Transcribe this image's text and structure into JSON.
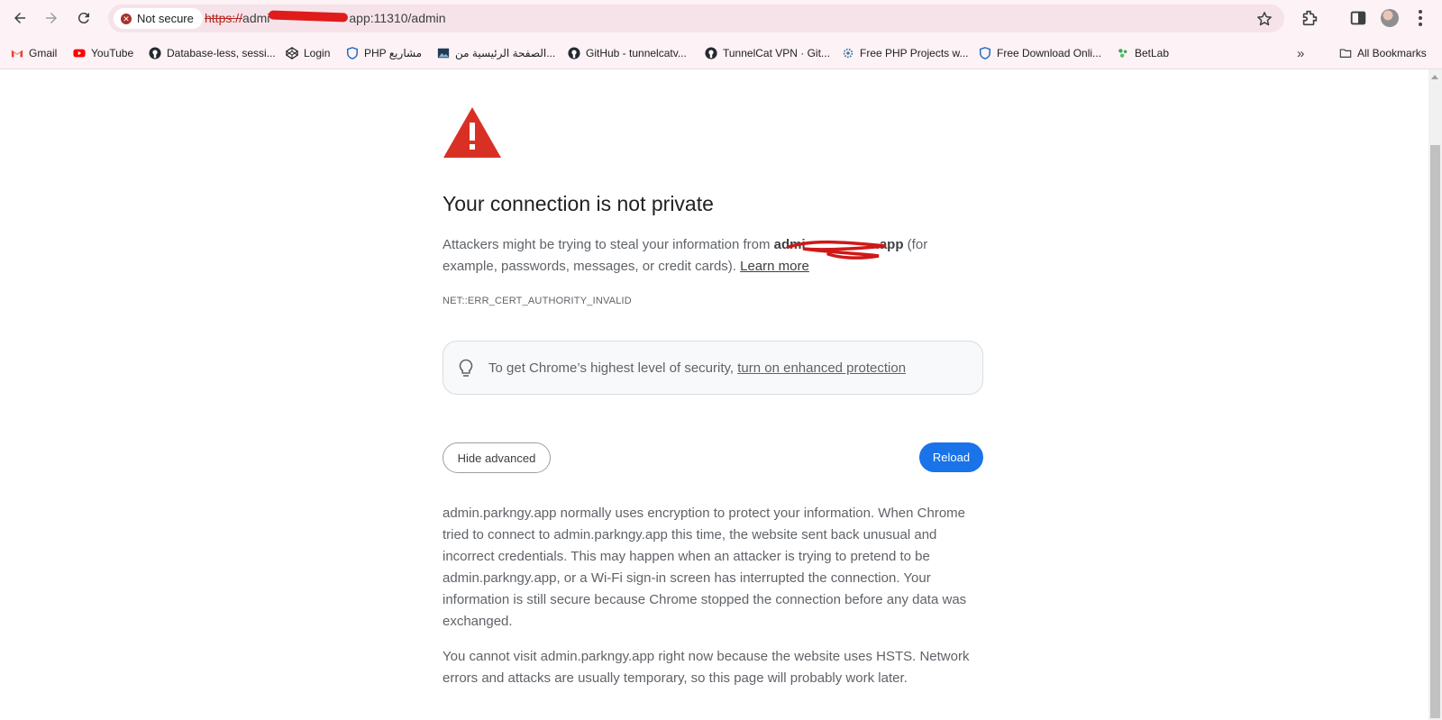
{
  "browser": {
    "security_chip": "Not secure",
    "url_scheme": "https://",
    "url_prefix": "admi",
    "url_suffix": "app:11310/admin"
  },
  "bookmarks": {
    "items": [
      {
        "label": "Gmail",
        "icon": "gmail-icon"
      },
      {
        "label": "YouTube",
        "icon": "youtube-icon"
      },
      {
        "label": "Database-less, sessi...",
        "icon": "github-icon"
      },
      {
        "label": "Login",
        "icon": "codepen-icon"
      },
      {
        "label": "PHP مشاريع",
        "icon": "shield-icon"
      },
      {
        "label": "الصفحة الرئيسية من...",
        "icon": "image-icon"
      },
      {
        "label": "GitHub - tunnelcatv...",
        "icon": "github-icon"
      },
      {
        "label": "TunnelCat VPN · Git...",
        "icon": "github-icon"
      },
      {
        "label": "Free PHP Projects w...",
        "icon": "gear-icon"
      },
      {
        "label": "Free Download Onli...",
        "icon": "shield-icon"
      },
      {
        "label": "BetLab",
        "icon": "leaf-icon"
      }
    ],
    "all_bookmarks": "All Bookmarks"
  },
  "page": {
    "title": "Your connection is not private",
    "message_before": "Attackers might be trying to steal your information from ",
    "host_visible": "admi",
    "host_end": ".app",
    "message_after": " (for example, passwords, messages, or credit cards). ",
    "learn_more": "Learn more",
    "error_code": "NET::ERR_CERT_AUTHORITY_INVALID",
    "enhanced_text": "To get Chrome’s highest level of security, ",
    "enhanced_link": "turn on enhanced protection",
    "hide_advanced": "Hide advanced",
    "reload": "Reload",
    "details_1": "admin.parkngy.app normally uses encryption to protect your information. When Chrome tried to connect to admin.parkngy.app this time, the website sent back unusual and incorrect credentials. This may happen when an attacker is trying to pretend to be admin.parkngy.app, or a Wi-Fi sign-in screen has interrupted the connection. Your information is still secure because Chrome stopped the connection before any data was exchanged.",
    "details_2": "You cannot visit admin.parkngy.app right now because the website uses HSTS. Network errors and attacks are usually temporary, so this page will probably work later."
  },
  "colors": {
    "primary": "#1a73e8",
    "danger": "#d93025",
    "chrome_bg": "#fdf2f5"
  }
}
